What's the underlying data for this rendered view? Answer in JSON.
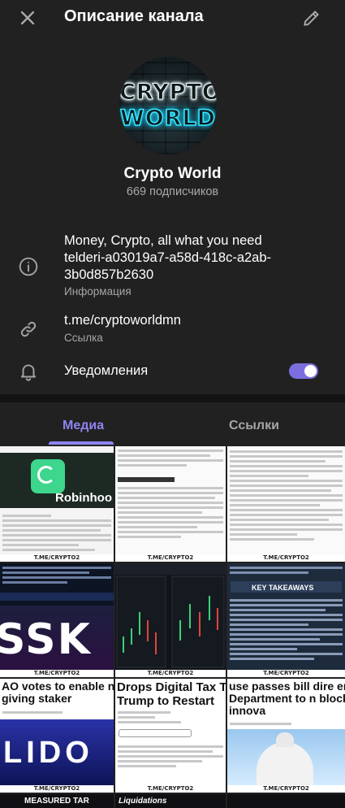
{
  "header": {
    "title": "Описание канала",
    "close_icon": "close-icon",
    "edit_icon": "pencil-icon"
  },
  "channel": {
    "avatar_line1": "CRYPTO",
    "avatar_line2": "WORLD",
    "name": "Crypto World",
    "subscribers": "669 подписчиков"
  },
  "info": {
    "description": "Money, Crypto, all what you need\n telderi-a03019a7-a58d-418c-a2ab-\n3b0d857b2630",
    "description_label": "Информация",
    "link": "t.me/cryptoworldmn",
    "link_label": "Ссылка",
    "notifications_label": "Уведомления",
    "notifications_on": true
  },
  "tabs": [
    {
      "label": "Медиа",
      "active": true
    },
    {
      "label": "Ссылки",
      "active": false
    }
  ],
  "media": {
    "caption": "T.ME/CRYPTO2",
    "tiles": [
      {
        "headline": "Robinhood"
      },
      {
        "headline": ""
      },
      {
        "headline": ""
      },
      {
        "headline": "SSK"
      },
      {
        "headline": ""
      },
      {
        "headline": "KEY TAKEAWAYS"
      },
      {
        "headline": "AO votes to enable nance, giving staker"
      },
      {
        "headline": "Drops Digital Tax T ted Trump to Restart"
      },
      {
        "headline": "use passes bill dire erce Department to n blockchain innova"
      },
      {
        "headline": "MEASURED TAR"
      },
      {
        "headline": "Liquidations"
      }
    ]
  },
  "colors": {
    "background": "#212121",
    "accent": "#8e84f0",
    "secondary_text": "#a6a6a6"
  }
}
